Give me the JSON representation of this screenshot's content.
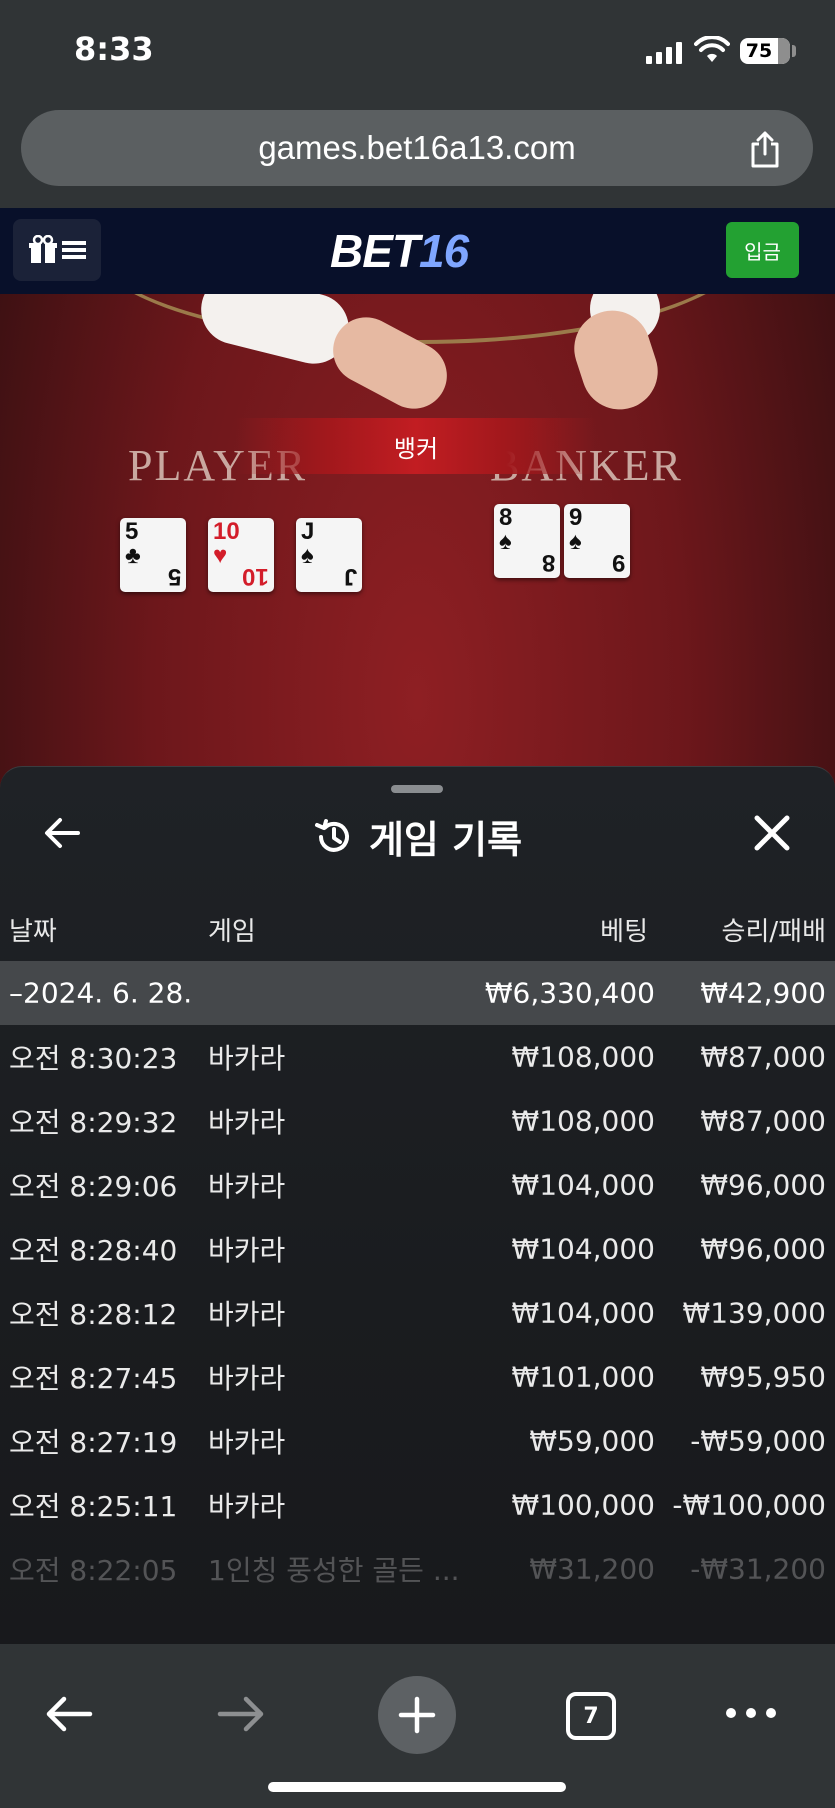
{
  "status_bar": {
    "time": "8:33",
    "battery": "75"
  },
  "browser": {
    "url": "games.bet16a13.com",
    "tab_count": "7"
  },
  "site": {
    "logo_part1": "BET",
    "logo_part2": "16",
    "deposit_label": "입금"
  },
  "game": {
    "player_label": "PLAYER",
    "banker_label": "BANKER",
    "result_label": "뱅커",
    "player_cards": [
      {
        "rank": "5",
        "suit": "♣",
        "color": "black"
      },
      {
        "rank": "10",
        "suit": "♥",
        "color": "red"
      },
      {
        "rank": "J",
        "suit": "♠",
        "color": "black"
      }
    ],
    "banker_cards": [
      {
        "rank": "8",
        "suit": "♠",
        "color": "black"
      },
      {
        "rank": "9",
        "suit": "♠",
        "color": "black"
      }
    ]
  },
  "history": {
    "title": "게임 기록",
    "columns": {
      "date": "날짜",
      "game": "게임",
      "bet": "베팅",
      "winloss": "승리/패배"
    },
    "date_group": {
      "date": "–2024. 6. 28.",
      "bet_total": "₩6,330,400",
      "winloss_total": "₩42,900"
    },
    "rows": [
      {
        "time": "오전 8:30:23",
        "game": "바카라",
        "bet": "₩108,000",
        "winloss": "₩87,000"
      },
      {
        "time": "오전 8:29:32",
        "game": "바카라",
        "bet": "₩108,000",
        "winloss": "₩87,000"
      },
      {
        "time": "오전 8:29:06",
        "game": "바카라",
        "bet": "₩104,000",
        "winloss": "₩96,000"
      },
      {
        "time": "오전 8:28:40",
        "game": "바카라",
        "bet": "₩104,000",
        "winloss": "₩96,000"
      },
      {
        "time": "오전 8:28:12",
        "game": "바카라",
        "bet": "₩104,000",
        "winloss": "₩139,000"
      },
      {
        "time": "오전 8:27:45",
        "game": "바카라",
        "bet": "₩101,000",
        "winloss": "₩95,950"
      },
      {
        "time": "오전 8:27:19",
        "game": "바카라",
        "bet": "₩59,000",
        "winloss": "-₩59,000"
      },
      {
        "time": "오전 8:25:11",
        "game": "바카라",
        "bet": "₩100,000",
        "winloss": "-₩100,000"
      },
      {
        "time": "오전 8:22:05",
        "game": "1인칭 풍성한 골든 ...",
        "bet": "₩31,200",
        "winloss": "-₩31,200"
      }
    ]
  }
}
